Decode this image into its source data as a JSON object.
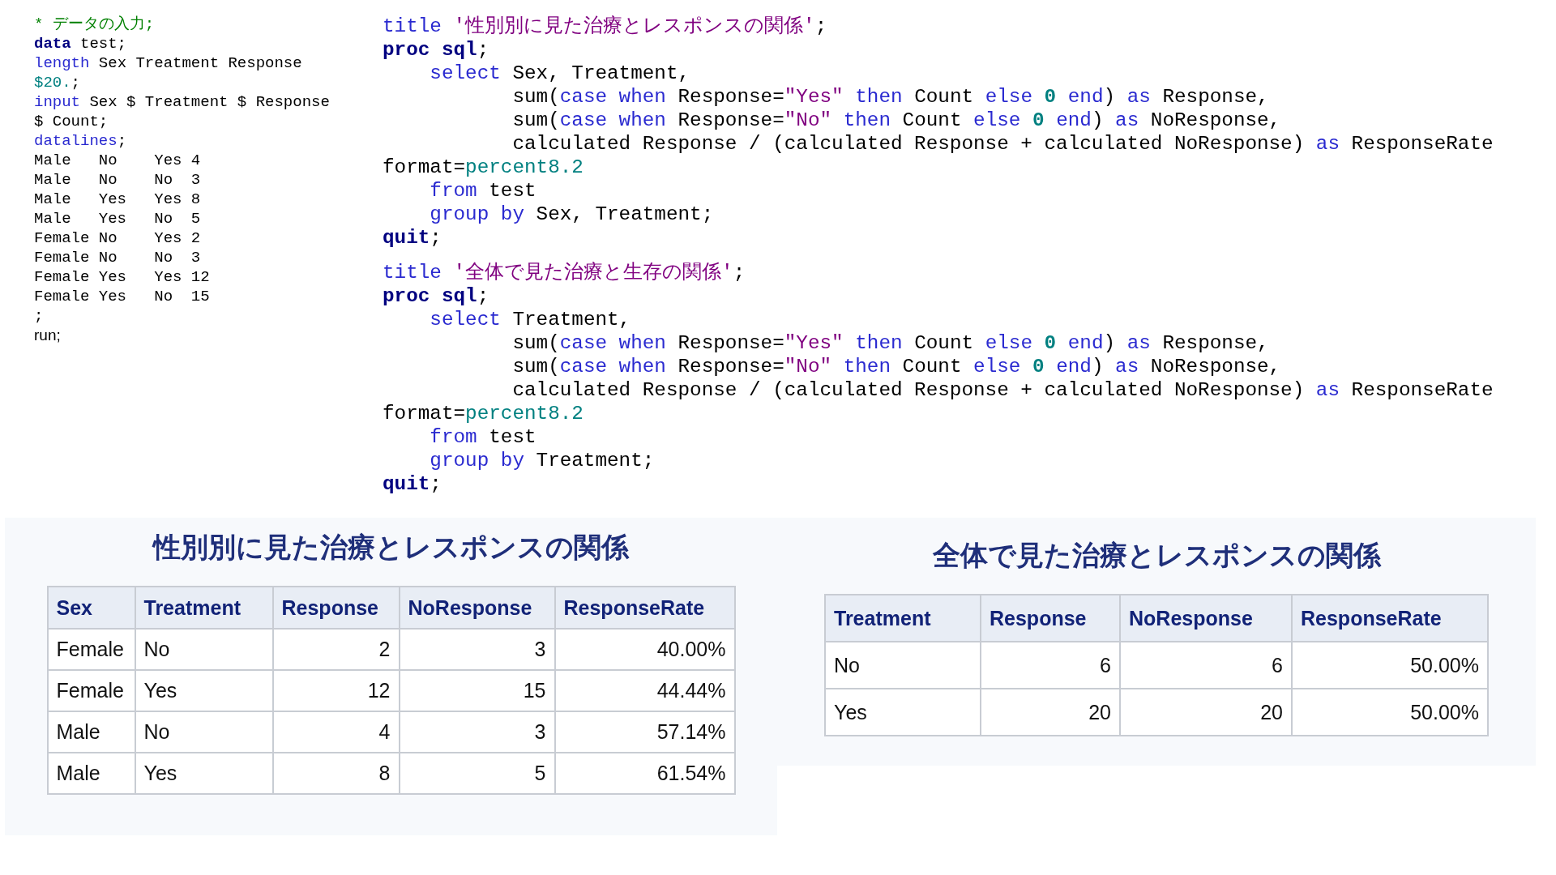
{
  "left_code": {
    "lines": [
      {
        "tokens": [
          {
            "kind": "comment",
            "text": "* データの入力;"
          }
        ]
      },
      {
        "tokens": [
          {
            "kind": "kwb",
            "text": "data"
          },
          {
            "kind": "plain",
            "text": " test;"
          }
        ]
      },
      {
        "tokens": [
          {
            "kind": "kw",
            "text": "length"
          },
          {
            "kind": "plain",
            "text": " Sex Treatment Response"
          }
        ]
      },
      {
        "tokens": [
          {
            "kind": "fmt",
            "text": "$20."
          },
          {
            "kind": "plain",
            "text": ";"
          }
        ]
      },
      {
        "tokens": [
          {
            "kind": "kw",
            "text": "input"
          },
          {
            "kind": "plain",
            "text": " Sex $ Treatment $ Response"
          }
        ]
      },
      {
        "tokens": [
          {
            "kind": "plain",
            "text": "$ Count;"
          }
        ]
      },
      {
        "tokens": [
          {
            "kind": "kw",
            "text": "datalines"
          },
          {
            "kind": "plain",
            "text": ";"
          }
        ]
      },
      {
        "tokens": [
          {
            "kind": "plain",
            "text": "Male   No    Yes 4"
          }
        ]
      },
      {
        "tokens": [
          {
            "kind": "plain",
            "text": "Male   No    No  3"
          }
        ]
      },
      {
        "tokens": [
          {
            "kind": "plain",
            "text": "Male   Yes   Yes 8"
          }
        ]
      },
      {
        "tokens": [
          {
            "kind": "plain",
            "text": "Male   Yes   No  5"
          }
        ]
      },
      {
        "tokens": [
          {
            "kind": "plain",
            "text": "Female No    Yes 2"
          }
        ]
      },
      {
        "tokens": [
          {
            "kind": "plain",
            "text": "Female No    No  3"
          }
        ]
      },
      {
        "tokens": [
          {
            "kind": "plain",
            "text": "Female Yes   Yes 12"
          }
        ]
      },
      {
        "tokens": [
          {
            "kind": "plain",
            "text": "Female Yes   No  15"
          }
        ]
      },
      {
        "tokens": [
          {
            "kind": "plain",
            "text": ";"
          }
        ]
      },
      {
        "tokens": [
          {
            "kind": "sans",
            "text": "run;"
          }
        ]
      }
    ]
  },
  "right_code": {
    "blocks": [
      {
        "lines": [
          {
            "tokens": [
              {
                "kind": "kw",
                "text": "title"
              },
              {
                "kind": "str",
                "text": " '性別別に見た治療とレスポンスの関係'"
              },
              {
                "kind": "plain",
                "text": ";"
              }
            ]
          },
          {
            "tokens": [
              {
                "kind": "kwb",
                "text": "proc sql"
              },
              {
                "kind": "plain",
                "text": ";"
              }
            ]
          },
          {
            "tokens": [
              {
                "kind": "kw",
                "text": "    select"
              },
              {
                "kind": "plain",
                "text": " Sex, Treatment,"
              }
            ]
          },
          {
            "tokens": [
              {
                "kind": "plain",
                "text": "           sum("
              },
              {
                "kind": "kw",
                "text": "case when"
              },
              {
                "kind": "plain",
                "text": " Response="
              },
              {
                "kind": "str",
                "text": "\"Yes\""
              },
              {
                "kind": "kw",
                "text": " then"
              },
              {
                "kind": "plain",
                "text": " Count"
              },
              {
                "kind": "kw",
                "text": " else"
              },
              {
                "kind": "num",
                "text": " 0"
              },
              {
                "kind": "kw",
                "text": " end"
              },
              {
                "kind": "plain",
                "text": ")"
              },
              {
                "kind": "kw",
                "text": " as"
              },
              {
                "kind": "plain",
                "text": " Response,"
              }
            ]
          },
          {
            "tokens": [
              {
                "kind": "plain",
                "text": "           sum("
              },
              {
                "kind": "kw",
                "text": "case when"
              },
              {
                "kind": "plain",
                "text": " Response="
              },
              {
                "kind": "str",
                "text": "\"No\""
              },
              {
                "kind": "kw",
                "text": " then"
              },
              {
                "kind": "plain",
                "text": " Count"
              },
              {
                "kind": "kw",
                "text": " else"
              },
              {
                "kind": "num",
                "text": " 0"
              },
              {
                "kind": "kw",
                "text": " end"
              },
              {
                "kind": "plain",
                "text": ")"
              },
              {
                "kind": "kw",
                "text": " as"
              },
              {
                "kind": "plain",
                "text": " NoResponse,"
              }
            ]
          },
          {
            "tokens": [
              {
                "kind": "plain",
                "text": "           calculated Response / (calculated Response + calculated NoResponse)"
              },
              {
                "kind": "kw",
                "text": " as"
              },
              {
                "kind": "plain",
                "text": " ResponseRate"
              }
            ]
          },
          {
            "tokens": [
              {
                "kind": "plain",
                "text": "format="
              },
              {
                "kind": "fmt",
                "text": "percent8.2"
              }
            ]
          },
          {
            "tokens": [
              {
                "kind": "kw",
                "text": "    from"
              },
              {
                "kind": "plain",
                "text": " test"
              }
            ]
          },
          {
            "tokens": [
              {
                "kind": "kw",
                "text": "    group by"
              },
              {
                "kind": "plain",
                "text": " Sex, Treatment;"
              }
            ]
          },
          {
            "tokens": [
              {
                "kind": "kwb",
                "text": "quit"
              },
              {
                "kind": "plain",
                "text": ";"
              }
            ]
          }
        ]
      },
      {
        "lines": [
          {
            "tokens": [
              {
                "kind": "kw",
                "text": "title"
              },
              {
                "kind": "str",
                "text": " '全体で見た治療と生存の関係'"
              },
              {
                "kind": "plain",
                "text": ";"
              }
            ]
          },
          {
            "tokens": [
              {
                "kind": "kwb",
                "text": "proc sql"
              },
              {
                "kind": "plain",
                "text": ";"
              }
            ]
          },
          {
            "tokens": [
              {
                "kind": "kw",
                "text": "    select"
              },
              {
                "kind": "plain",
                "text": " Treatment,"
              }
            ]
          },
          {
            "tokens": [
              {
                "kind": "plain",
                "text": "           sum("
              },
              {
                "kind": "kw",
                "text": "case when"
              },
              {
                "kind": "plain",
                "text": " Response="
              },
              {
                "kind": "str",
                "text": "\"Yes\""
              },
              {
                "kind": "kw",
                "text": " then"
              },
              {
                "kind": "plain",
                "text": " Count"
              },
              {
                "kind": "kw",
                "text": " else"
              },
              {
                "kind": "num",
                "text": " 0"
              },
              {
                "kind": "kw",
                "text": " end"
              },
              {
                "kind": "plain",
                "text": ")"
              },
              {
                "kind": "kw",
                "text": " as"
              },
              {
                "kind": "plain",
                "text": " Response,"
              }
            ]
          },
          {
            "tokens": [
              {
                "kind": "plain",
                "text": "           sum("
              },
              {
                "kind": "kw",
                "text": "case when"
              },
              {
                "kind": "plain",
                "text": " Response="
              },
              {
                "kind": "str",
                "text": "\"No\""
              },
              {
                "kind": "kw",
                "text": " then"
              },
              {
                "kind": "plain",
                "text": " Count"
              },
              {
                "kind": "kw",
                "text": " else"
              },
              {
                "kind": "num",
                "text": " 0"
              },
              {
                "kind": "kw",
                "text": " end"
              },
              {
                "kind": "plain",
                "text": ")"
              },
              {
                "kind": "kw",
                "text": " as"
              },
              {
                "kind": "plain",
                "text": " NoResponse,"
              }
            ]
          },
          {
            "tokens": [
              {
                "kind": "plain",
                "text": "           calculated Response / (calculated Response + calculated NoResponse)"
              },
              {
                "kind": "kw",
                "text": " as"
              },
              {
                "kind": "plain",
                "text": " ResponseRate"
              }
            ]
          },
          {
            "tokens": [
              {
                "kind": "plain",
                "text": "format="
              },
              {
                "kind": "fmt",
                "text": "percent8.2"
              }
            ]
          },
          {
            "tokens": [
              {
                "kind": "kw",
                "text": "    from"
              },
              {
                "kind": "plain",
                "text": " test"
              }
            ]
          },
          {
            "tokens": [
              {
                "kind": "kw",
                "text": "    group by"
              },
              {
                "kind": "plain",
                "text": " Treatment;"
              }
            ]
          },
          {
            "tokens": [
              {
                "kind": "kwb",
                "text": "quit"
              },
              {
                "kind": "plain",
                "text": ";"
              }
            ]
          }
        ]
      }
    ]
  },
  "outputs": [
    {
      "title": "性別別に見た治療とレスポンスの関係",
      "table": {
        "columns": [
          {
            "label": "Sex",
            "kind": "text"
          },
          {
            "label": "Treatment",
            "kind": "text"
          },
          {
            "label": "Response",
            "kind": "number"
          },
          {
            "label": "NoResponse",
            "kind": "number"
          },
          {
            "label": "ResponseRate",
            "kind": "number"
          }
        ],
        "rows": [
          [
            "Female",
            "No",
            "2",
            "3",
            "40.00%"
          ],
          [
            "Female",
            "Yes",
            "12",
            "15",
            "44.44%"
          ],
          [
            "Male",
            "No",
            "4",
            "3",
            "57.14%"
          ],
          [
            "Male",
            "Yes",
            "8",
            "5",
            "61.54%"
          ]
        ]
      }
    },
    {
      "title": "全体で見た治療とレスポンスの関係",
      "table": {
        "columns": [
          {
            "label": "Treatment",
            "kind": "text"
          },
          {
            "label": "Response",
            "kind": "number"
          },
          {
            "label": "NoResponse",
            "kind": "number"
          },
          {
            "label": "ResponseRate",
            "kind": "number"
          }
        ],
        "rows": [
          [
            "No",
            "6",
            "6",
            "50.00%"
          ],
          [
            "Yes",
            "20",
            "20",
            "50.00%"
          ]
        ]
      }
    }
  ]
}
